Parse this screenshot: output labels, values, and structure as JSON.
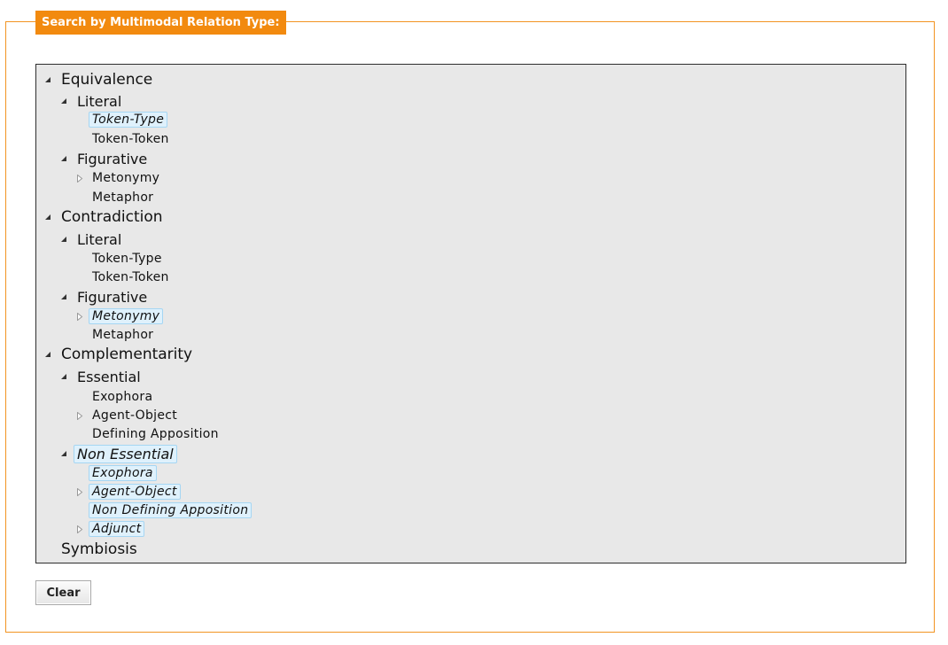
{
  "legend": "Search by Multimodal Relation Type:",
  "colors": {
    "accent": "#f28a0f",
    "selected_bg": "#dff1fc",
    "selected_border": "#a5d6f3",
    "tree_bg": "#e8e8e8"
  },
  "tree": [
    {
      "label": "Equivalence",
      "level": 0,
      "toggle": "expanded",
      "selected": false
    },
    {
      "label": "Literal",
      "level": 1,
      "toggle": "expanded",
      "selected": false
    },
    {
      "label": "Token-Type",
      "level": 2,
      "toggle": "none",
      "selected": true
    },
    {
      "label": "Token-Token",
      "level": 2,
      "toggle": "none",
      "selected": false
    },
    {
      "label": "Figurative",
      "level": 1,
      "toggle": "expanded",
      "selected": false
    },
    {
      "label": "Metonymy",
      "level": 2,
      "toggle": "collapsed",
      "selected": false
    },
    {
      "label": "Metaphor",
      "level": 2,
      "toggle": "none",
      "selected": false
    },
    {
      "label": "Contradiction",
      "level": 0,
      "toggle": "expanded",
      "selected": false
    },
    {
      "label": "Literal",
      "level": 1,
      "toggle": "expanded",
      "selected": false
    },
    {
      "label": "Token-Type",
      "level": 2,
      "toggle": "none",
      "selected": false
    },
    {
      "label": "Token-Token",
      "level": 2,
      "toggle": "none",
      "selected": false
    },
    {
      "label": "Figurative",
      "level": 1,
      "toggle": "expanded",
      "selected": false
    },
    {
      "label": "Metonymy",
      "level": 2,
      "toggle": "collapsed",
      "selected": true
    },
    {
      "label": "Metaphor",
      "level": 2,
      "toggle": "none",
      "selected": false
    },
    {
      "label": "Complementarity",
      "level": 0,
      "toggle": "expanded",
      "selected": false
    },
    {
      "label": "Essential",
      "level": 1,
      "toggle": "expanded",
      "selected": false
    },
    {
      "label": "Exophora",
      "level": 2,
      "toggle": "none",
      "selected": false
    },
    {
      "label": "Agent-Object",
      "level": 2,
      "toggle": "collapsed",
      "selected": false
    },
    {
      "label": "Defining Apposition",
      "level": 2,
      "toggle": "none",
      "selected": false
    },
    {
      "label": "Non Essential",
      "level": 1,
      "toggle": "expanded",
      "selected": true
    },
    {
      "label": "Exophora",
      "level": 2,
      "toggle": "none",
      "selected": true
    },
    {
      "label": "Agent-Object",
      "level": 2,
      "toggle": "collapsed",
      "selected": true
    },
    {
      "label": "Non Defining Apposition",
      "level": 2,
      "toggle": "none",
      "selected": true
    },
    {
      "label": "Adjunct",
      "level": 2,
      "toggle": "collapsed",
      "selected": true
    },
    {
      "label": "Symbiosis",
      "level": 0,
      "toggle": "none",
      "selected": false
    }
  ],
  "clear_button": "Clear"
}
